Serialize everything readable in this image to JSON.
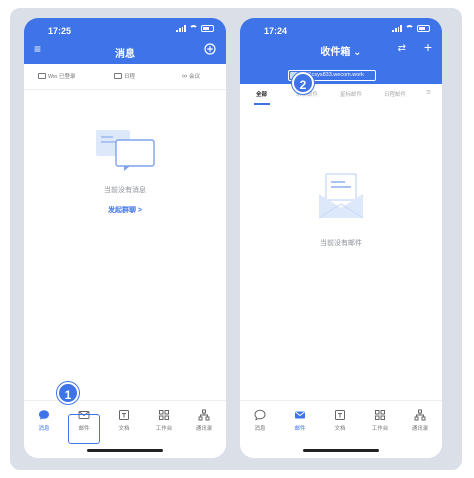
{
  "left_screen": {
    "status_time": "17:25",
    "title": "消息",
    "toolbar": [
      "Win 已登录",
      "日程",
      "会议"
    ],
    "empty_text": "当前没有消息",
    "empty_link": "发起群聊 >",
    "tabs": [
      "消息",
      "邮件",
      "文档",
      "工作台",
      "通讯录"
    ],
    "active_tab_index": 0,
    "highlight_tab_index": 1,
    "step_badge": "1"
  },
  "right_screen": {
    "status_time": "17:24",
    "title": "收件箱 ⌄",
    "email_address": "@csys833.wecom.work",
    "filter_tabs": [
      "全部",
      "未读邮件",
      "星标邮件",
      "日程邮件"
    ],
    "active_filter_index": 0,
    "empty_text": "当前没有邮件",
    "tabs": [
      "消息",
      "邮件",
      "文档",
      "工作台",
      "通讯录"
    ],
    "active_tab_index": 1,
    "step_badge": "2"
  },
  "colors": {
    "accent": "#3f73e8",
    "frame_bg": "#dbe0e8"
  }
}
